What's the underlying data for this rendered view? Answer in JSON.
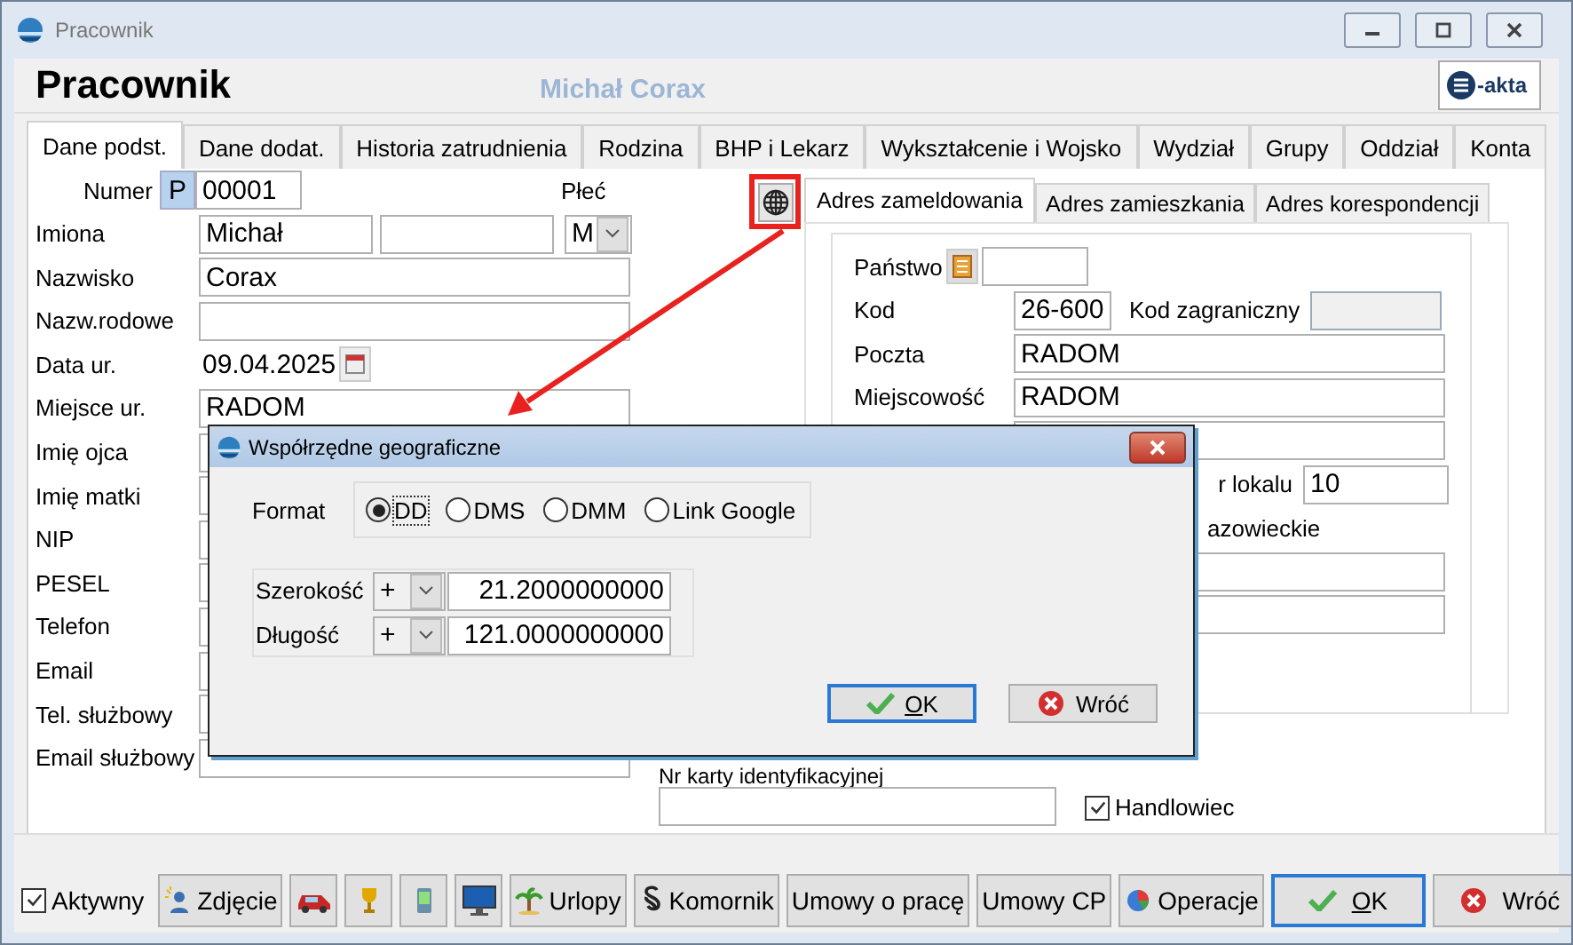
{
  "window": {
    "title": "Pracownik"
  },
  "header": {
    "title": "Pracownik",
    "subtitle": "Michał Corax",
    "logo_text": "-akta"
  },
  "tabs": [
    {
      "label": "Dane podst.",
      "selected": true
    },
    {
      "label": "Dane dodat.",
      "selected": false
    },
    {
      "label": "Historia zatrudnienia",
      "selected": false
    },
    {
      "label": "Rodzina",
      "selected": false
    },
    {
      "label": "BHP i Lekarz",
      "selected": false
    },
    {
      "label": "Wykształcenie i Wojsko",
      "selected": false
    },
    {
      "label": "Wydział",
      "selected": false
    },
    {
      "label": "Grupy",
      "selected": false
    },
    {
      "label": "Oddział",
      "selected": false
    },
    {
      "label": "Konta",
      "selected": false
    }
  ],
  "person": [
    {
      "kind": "number",
      "label": "Numer",
      "prefix": "P",
      "value": "00001",
      "gender_label": "Płeć"
    },
    {
      "kind": "name",
      "label": "Imiona",
      "value": "Michał",
      "gender": "M"
    },
    {
      "kind": "text",
      "label": "Nazwisko",
      "value": "Corax"
    },
    {
      "kind": "text",
      "label": "Nazw.rodowe"
    },
    {
      "kind": "date",
      "label": "Data ur.",
      "value": "09.04.2025"
    },
    {
      "kind": "text",
      "label": "Miejsce ur.",
      "value": "RADOM"
    },
    {
      "kind": "text",
      "label": "Imię ojca"
    },
    {
      "kind": "text",
      "label": "Imię matki"
    },
    {
      "kind": "text",
      "label": "NIP"
    },
    {
      "kind": "text",
      "label": "PESEL"
    },
    {
      "kind": "text",
      "label": "Telefon"
    },
    {
      "kind": "text",
      "label": "Email"
    },
    {
      "kind": "text",
      "label": "Tel. służbowy"
    },
    {
      "kind": "text",
      "label": "Email służbowy"
    }
  ],
  "address_tabs": [
    {
      "label": "Adres zameldowania",
      "selected": true
    },
    {
      "label": "Adres zamieszkania",
      "selected": false
    },
    {
      "label": "Adres korespondencji",
      "selected": false
    }
  ],
  "address": [
    {
      "kind": "country",
      "label": "Państwo"
    },
    {
      "kind": "code",
      "label": "Kod",
      "value": "26-600",
      "foreign_label": "Kod zagraniczny"
    },
    {
      "kind": "text",
      "label": "Poczta",
      "value": "RADOM"
    },
    {
      "kind": "text",
      "label": "Miejscowość",
      "value": "RADOM"
    },
    {
      "kind": "blank"
    },
    {
      "kind": "partial",
      "label": "r lokalu",
      "value": "10"
    },
    {
      "kind": "note",
      "text": "azowieckie"
    },
    {
      "kind": "blank"
    },
    {
      "kind": "blank"
    }
  ],
  "id_card": {
    "label": "Nr karty identyfikacyjnej"
  },
  "salesman": {
    "label": "Handlowiec",
    "checked": true
  },
  "dialog": {
    "title": "Współrzędne geograficzne",
    "format_label": "Format",
    "formats": [
      {
        "label": "DD",
        "selected": true
      },
      {
        "label": "DMS",
        "selected": false
      },
      {
        "label": "DMM",
        "selected": false
      },
      {
        "label": "Link Google",
        "selected": false
      }
    ],
    "coords": [
      {
        "label": "Szerokość",
        "sign": "+",
        "value": "21.2000000000"
      },
      {
        "label": "Długość",
        "sign": "+",
        "value": "121.0000000000"
      }
    ],
    "ok": "OK",
    "cancel": "Wróć"
  },
  "active": {
    "label": "Aktywny",
    "checked": true
  },
  "toolbar": [
    {
      "kind": "photo",
      "label": "Zdjęcie"
    },
    {
      "kind": "car"
    },
    {
      "kind": "trophy"
    },
    {
      "kind": "phone"
    },
    {
      "kind": "monitor"
    },
    {
      "kind": "leave",
      "label": "Urlopy"
    },
    {
      "kind": "bailiff",
      "label": "Komornik"
    },
    {
      "kind": "plain",
      "label": "Umowy o pracę"
    },
    {
      "kind": "plain",
      "label": "Umowy CP"
    },
    {
      "kind": "operations",
      "label": "Operacje"
    }
  ],
  "ok": "OK",
  "cancel": "Wróć"
}
